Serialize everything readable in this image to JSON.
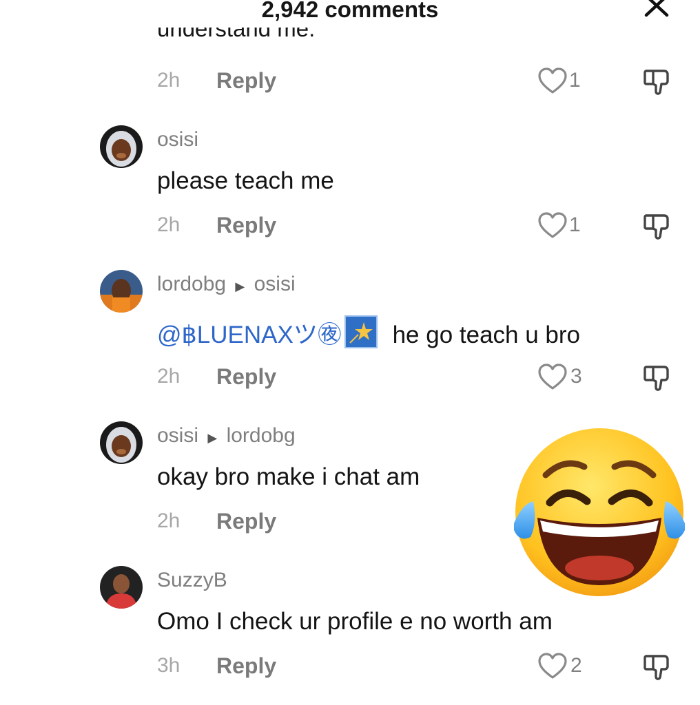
{
  "header": {
    "title": "2,942 comments"
  },
  "top_comment_partial": {
    "text_fragment": "understand me.",
    "time": "2h",
    "reply_label": "Reply",
    "likes": "1"
  },
  "comments": [
    {
      "username": "osisi",
      "reply_to": "",
      "text": "please teach me",
      "time": "2h",
      "reply_label": "Reply",
      "likes": "1"
    },
    {
      "username": "lordobg",
      "reply_to": "osisi",
      "mention": "@฿LUENAXツ㊰",
      "text": "he go teach u bro",
      "time": "2h",
      "reply_label": "Reply",
      "likes": "3"
    },
    {
      "username": "osisi",
      "reply_to": "lordobg",
      "text": "okay bro make i chat am",
      "time": "2h",
      "reply_label": "Reply",
      "likes": ""
    },
    {
      "username": "SuzzyB",
      "reply_to": "",
      "text": "Omo I check ur profile e no worth am",
      "time": "3h",
      "reply_label": "Reply",
      "likes": "2"
    }
  ],
  "overlay": {
    "icon": "face-with-tears-of-joy-emoji"
  },
  "colors": {
    "mention": "#2e67c9",
    "muted": "#a7a7a7",
    "reply": "#7a7a7a"
  }
}
